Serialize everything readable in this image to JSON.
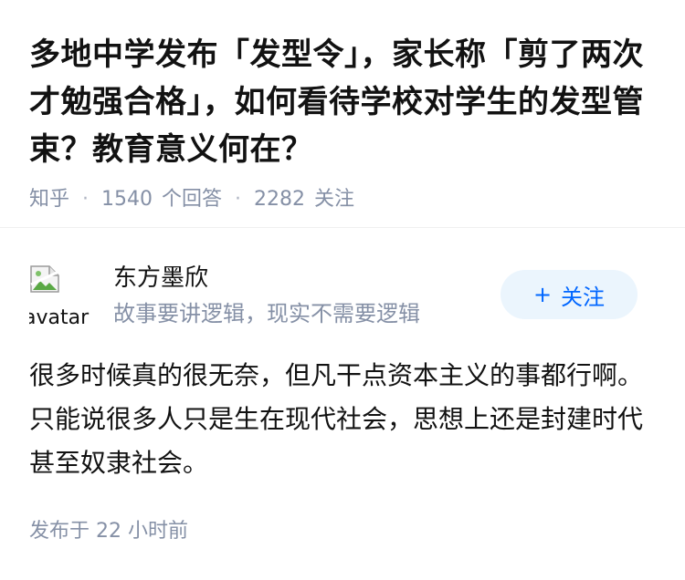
{
  "question": {
    "title": "多地中学发布「发型令」，家长称「剪了两次才勉强合格」，如何看待学校对学生的发型管束？教育意义何在？",
    "source": "知乎",
    "answer_count": "1540",
    "answer_label": "个回答",
    "follower_count": "2282",
    "follower_label": "关注"
  },
  "answer": {
    "author": {
      "name": "东方墨欣",
      "bio": "故事要讲逻辑，现实不需要逻辑",
      "avatar_alt": "avatar"
    },
    "follow_button": {
      "plus": "+",
      "label": "关注"
    },
    "content": "很多时候真的很无奈，但凡干点资本主义的事都行啊。只能说很多人只是生在现代社会，思想上还是封建时代甚至奴隶社会。",
    "publish_time": "发布于 22 小时前"
  },
  "colors": {
    "accent": "#0066ff",
    "follow_bg": "#ebf5fd",
    "meta_text": "#8590a6",
    "primary_text": "#121212"
  }
}
